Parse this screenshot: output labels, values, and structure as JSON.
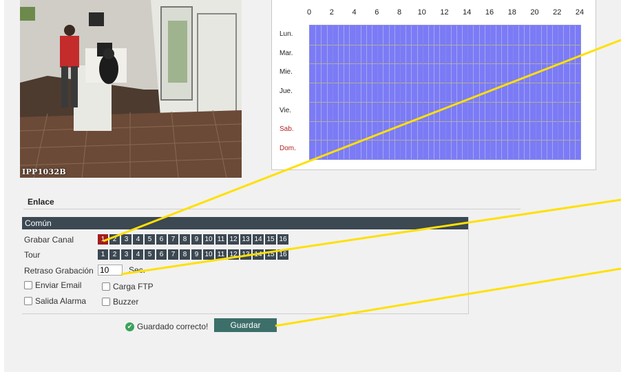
{
  "camera": {
    "label": "IPP1032B"
  },
  "schedule": {
    "hours": [
      "0",
      "2",
      "4",
      "6",
      "8",
      "10",
      "12",
      "14",
      "16",
      "18",
      "20",
      "22",
      "24"
    ],
    "days": [
      "Lun.",
      "Mar.",
      "Mie.",
      "Jue.",
      "Vie.",
      "Sab.",
      "Dom."
    ],
    "grid_color": "#7b7bf7"
  },
  "linkage": {
    "title": "Enlace",
    "common_header": "Común",
    "record_channel_label": "Grabar Canal",
    "tour_label": "Tour",
    "channels": [
      "1",
      "2",
      "3",
      "4",
      "5",
      "6",
      "7",
      "8",
      "9",
      "10",
      "11",
      "12",
      "13",
      "14",
      "15",
      "16"
    ],
    "active_record_channel": "1",
    "delay_label": "Retraso Grabación",
    "delay_value": "10",
    "delay_unit": "Sec.",
    "options": {
      "email": "Enviar Email",
      "ftp": "Carga FTP",
      "alarm_out": "Salida Alarma",
      "buzzer": "Buzzer"
    },
    "saved_text": "Guardado correcto!",
    "save_label": "Guardar"
  },
  "colors": {
    "header_bg": "#3c4852",
    "active_channel": "#a31c1c",
    "save_button": "#3d6f6a",
    "annotation_line": "#ffe000"
  }
}
